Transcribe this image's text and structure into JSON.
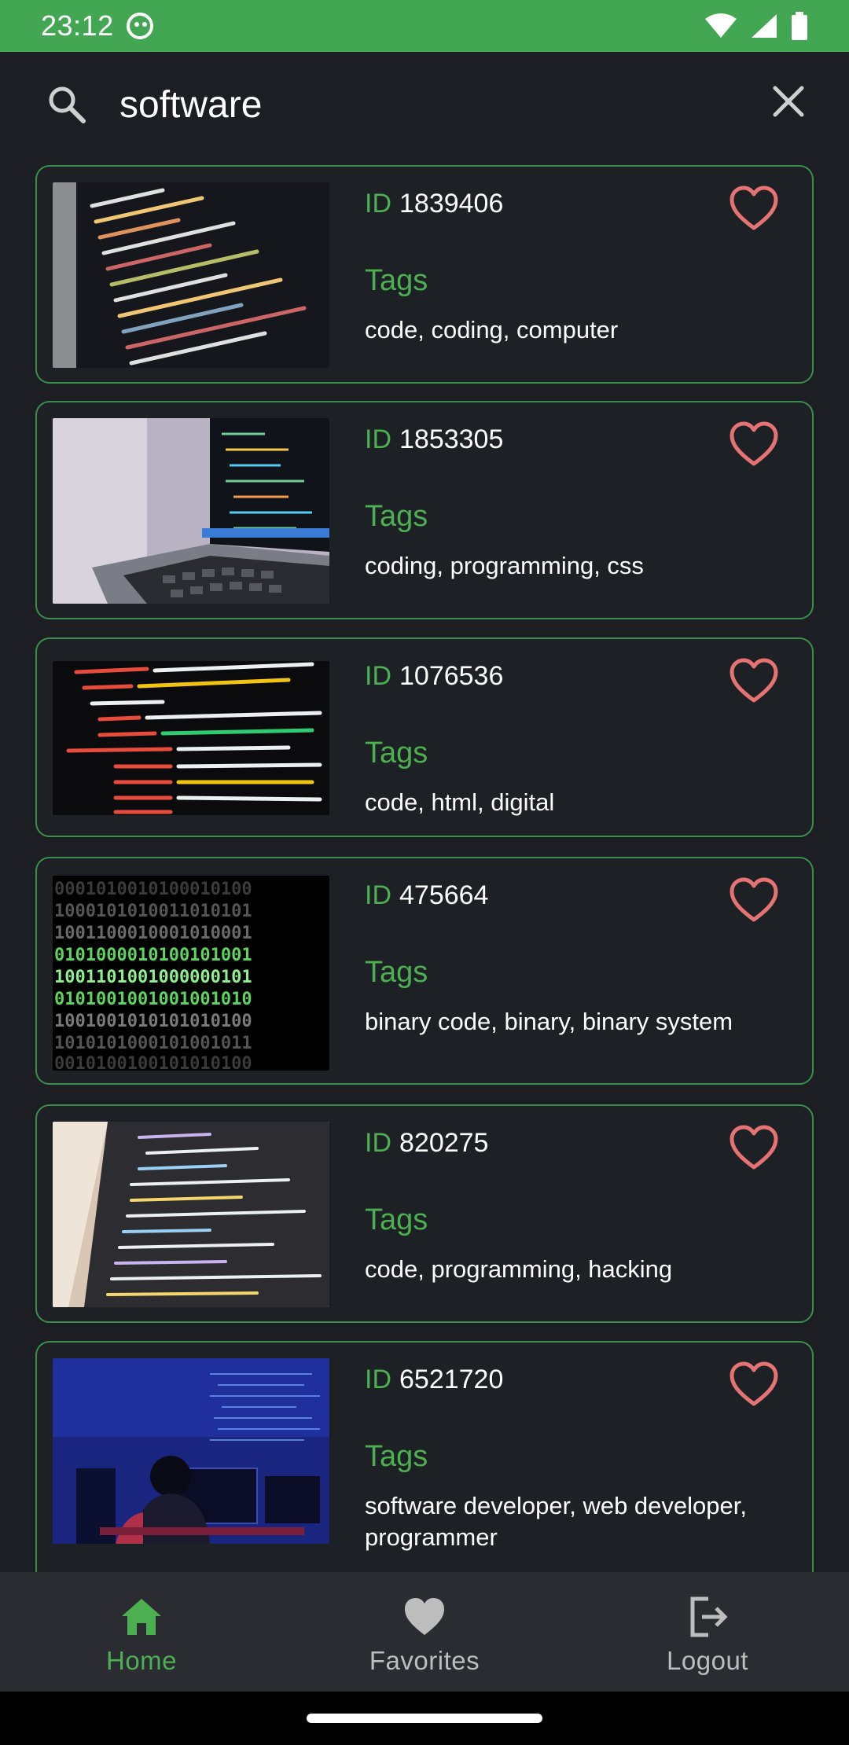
{
  "status_bar": {
    "time": "23:12"
  },
  "search": {
    "value": "software",
    "placeholder": ""
  },
  "results": [
    {
      "id_label": "ID",
      "id": "1839406",
      "tags_label": "Tags",
      "tags": "code, coding, computer"
    },
    {
      "id_label": "ID",
      "id": "1853305",
      "tags_label": "Tags",
      "tags": "coding, programming, css"
    },
    {
      "id_label": "ID",
      "id": "1076536",
      "tags_label": "Tags",
      "tags": "code, html, digital"
    },
    {
      "id_label": "ID",
      "id": "475664",
      "tags_label": "Tags",
      "tags": "binary code, binary, binary system"
    },
    {
      "id_label": "ID",
      "id": "820275",
      "tags_label": "Tags",
      "tags": "code, programming, hacking"
    },
    {
      "id_label": "ID",
      "id": "6521720",
      "tags_label": "Tags",
      "tags": "software developer, web developer, programmer"
    }
  ],
  "bottom_nav": {
    "items": [
      {
        "label": "Home",
        "icon": "home-icon",
        "active": true
      },
      {
        "label": "Favorites",
        "icon": "heart-icon",
        "active": false
      },
      {
        "label": "Logout",
        "icon": "logout-icon",
        "active": false
      }
    ]
  },
  "colors": {
    "accent": "#4caf50",
    "status_bar": "#43a652",
    "background": "#1c1e24",
    "favorite": "#e57373",
    "nav_background": "#2a2c31"
  }
}
